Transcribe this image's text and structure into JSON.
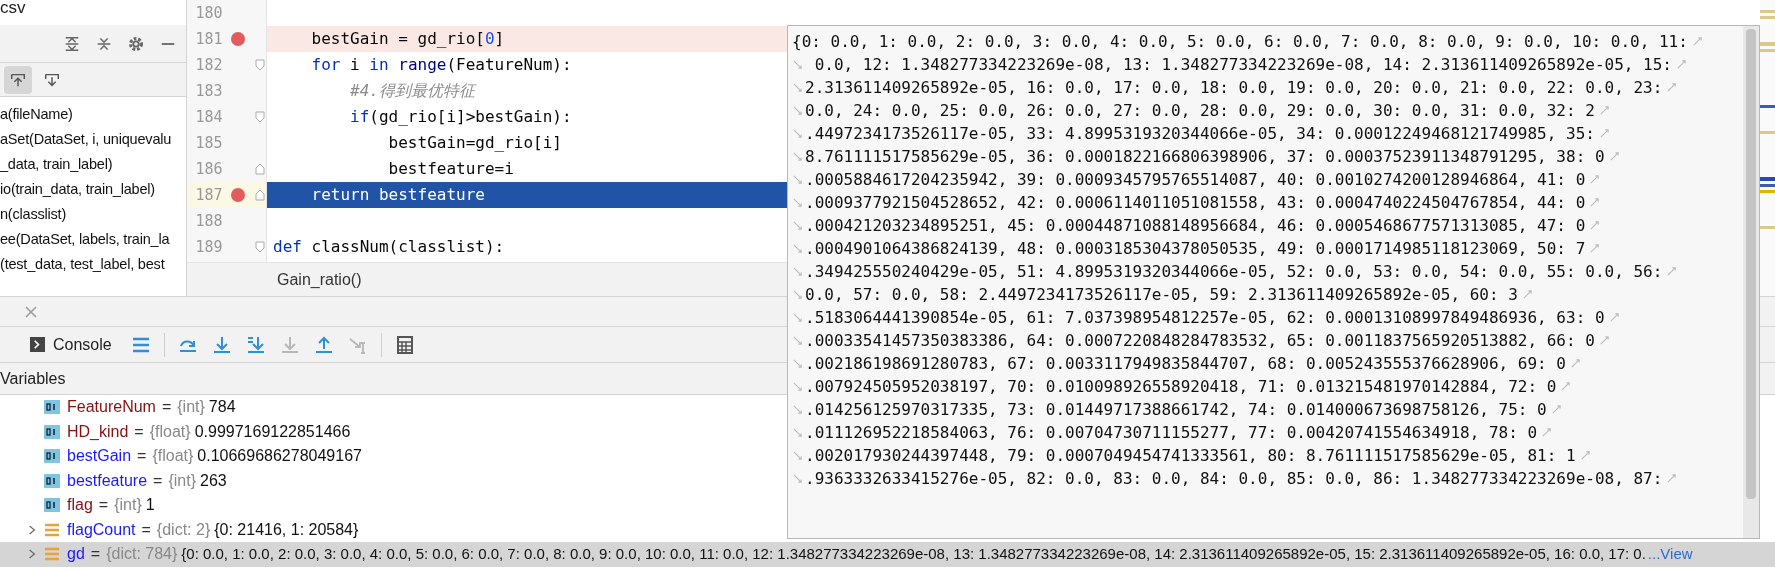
{
  "project_panel": {
    "file_name": "csv",
    "structure_items": [
      "a(fileName)",
      "aSet(DataSet, i, uniquevalu",
      "_data, train_label)",
      "io(train_data, train_label)",
      "n(classlist)",
      "ee(DataSet, labels, train_la",
      "(test_data, test_label, best"
    ],
    "tool_buttons": [
      {
        "kind": "autoscroll-to",
        "selected": true
      },
      {
        "kind": "autoscroll-from",
        "selected": false
      }
    ]
  },
  "editor": {
    "lines": [
      {
        "number": "180",
        "breakpoint": false,
        "current": false,
        "fold_start": false,
        "fold_end": false
      },
      {
        "number": "181",
        "breakpoint": true,
        "current": false,
        "fold_start": false,
        "fold_end": false,
        "code": [
          {
            "text": "    bestGain = gd_rio[",
            "kind": "plain"
          },
          {
            "text": "0",
            "kind": "number"
          },
          {
            "text": "]",
            "kind": "plain"
          }
        ]
      },
      {
        "number": "182",
        "breakpoint": false,
        "current": false,
        "fold_start": true,
        "fold_end": false,
        "code": [
          {
            "text": "    for",
            "kind": "keyword"
          },
          {
            "text": " i ",
            "kind": "plain"
          },
          {
            "text": "in",
            "kind": "keyword"
          },
          {
            "text": " range",
            "kind": "builtin"
          },
          {
            "text": "(FeatureNum):",
            "kind": "plain"
          }
        ]
      },
      {
        "number": "183",
        "breakpoint": false,
        "current": false,
        "fold_start": false,
        "fold_end": false,
        "code": [
          {
            "text": "        #4.得到最优特征",
            "kind": "comment"
          }
        ]
      },
      {
        "number": "184",
        "breakpoint": false,
        "current": false,
        "fold_start": true,
        "fold_end": false,
        "code": [
          {
            "text": "        if",
            "kind": "keyword"
          },
          {
            "text": "(gd_rio[i]>bestGain):",
            "kind": "plain"
          }
        ]
      },
      {
        "number": "185",
        "breakpoint": false,
        "current": false,
        "fold_start": false,
        "fold_end": false,
        "code": [
          {
            "text": "            bestGain=gd_rio[i]",
            "kind": "plain"
          }
        ]
      },
      {
        "number": "186",
        "breakpoint": false,
        "current": false,
        "fold_start": false,
        "fold_end": true,
        "code": [
          {
            "text": "            bestfeature=i",
            "kind": "plain"
          }
        ]
      },
      {
        "number": "187",
        "breakpoint": true,
        "current": true,
        "fold_start": false,
        "fold_end": true,
        "code": [
          {
            "text": "    return",
            "kind": "keyword"
          },
          {
            "text": " bestfeature",
            "kind": "plain"
          }
        ]
      },
      {
        "number": "188",
        "breakpoint": false,
        "current": false,
        "fold_start": false,
        "fold_end": false
      },
      {
        "number": "189",
        "breakpoint": false,
        "current": false,
        "fold_start": true,
        "fold_end": false,
        "code": [
          {
            "text": "def",
            "kind": "keyword"
          },
          {
            "text": " classNum(classlist):",
            "kind": "plain"
          }
        ]
      }
    ],
    "breadcrumb": "Gain_ratio()"
  },
  "value_popup": {
    "lines": [
      "{0: 0.0, 1: 0.0, 2: 0.0, 3: 0.0, 4: 0.0, 5: 0.0, 6: 0.0, 7: 0.0, 8: 0.0, 9: 0.0, 10: 0.0, 11:",
      " 0.0, 12: 1.348277334223269e-08, 13: 1.348277334223269e-08, 14: 2.313611409265892e-05, 15:",
      "2.313611409265892e-05, 16: 0.0, 17: 0.0, 18: 0.0, 19: 0.0, 20: 0.0, 21: 0.0, 22: 0.0, 23:",
      "0.0, 24: 0.0, 25: 0.0, 26: 0.0, 27: 0.0, 28: 0.0, 29: 0.0, 30: 0.0, 31: 0.0, 32: 2",
      ".4497234173526117e-05, 33: 4.8995319320344066e-05, 34: 0.00012249468121749985, 35:",
      "8.761111517585629e-05, 36: 0.0001822166806398906, 37: 0.00037523911348791295, 38: 0",
      ".0005884617204235942, 39: 0.0009345795765514087, 40: 0.0010274200128946864, 41: 0",
      ".0009377921504528652, 42: 0.0006114011051081558, 43: 0.0004740224504767854, 44: 0",
      ".000421203234895251, 45: 0.00044871088148956684, 46: 0.0005468677571313085, 47: 0",
      ".0004901064386824139, 48: 0.0003185304378050535, 49: 0.0001714985118123069, 50: 7",
      ".349425550240429e-05, 51: 4.8995319320344066e-05, 52: 0.0, 53: 0.0, 54: 0.0, 55: 0.0, 56:",
      "0.0, 57: 0.0, 58: 2.4497234173526117e-05, 59: 2.313611409265892e-05, 60: 3",
      ".5183064441390854e-05, 61: 7.037398954812257e-05, 62: 0.00013108997849486936, 63: 0",
      ".00033541457350383386, 64: 0.0007220848284783532, 65: 0.0011837565920513882, 66: 0",
      ".002186198691280783, 67: 0.0033117949835844707, 68: 0.005243555376628906, 69: 0",
      ".007924505952038197, 70: 0.010098926558920418, 71: 0.013215481970142884, 72: 0",
      ".014256125970317335, 73: 0.01449717388661742, 74: 0.014000673698758126, 75: 0",
      ".011126952218584063, 76: 0.00704730711155277, 77: 0.00420741554634918, 78: 0",
      ".002017930244397448, 79: 0.0007049454741333561, 80: 8.761111517585629e-05, 81: 1",
      ".9363332633415276e-05, 82: 0.0, 83: 0.0, 84: 0.0, 85: 0.0, 86: 1.348277334223269e-08, 87:"
    ]
  },
  "debug_panel": {
    "console_tab": "Console",
    "actions": [
      {
        "kind": "frames",
        "disabled": false
      },
      {
        "kind": "step-over",
        "disabled": false
      },
      {
        "kind": "step-into",
        "disabled": false
      },
      {
        "kind": "step-into-my-code",
        "disabled": false
      },
      {
        "kind": "force-step-into",
        "disabled": true
      },
      {
        "kind": "step-out",
        "disabled": false
      },
      {
        "kind": "run-to-cursor",
        "disabled": true
      },
      {
        "kind": "evaluate",
        "disabled": false
      }
    ],
    "variables_title": "Variables",
    "variables": [
      {
        "kind": "scalar",
        "name": "FeatureNum",
        "color": "#871010",
        "separator": "=",
        "type": "{int}",
        "value": "784",
        "selected": false
      },
      {
        "kind": "scalar",
        "name": "HD_kind",
        "color": "#871010",
        "separator": "=",
        "type": "{float}",
        "value": "0.9997169122851466",
        "selected": false
      },
      {
        "kind": "scalar",
        "name": "bestGain",
        "color": "#1a1aff",
        "separator": "=",
        "type": "{float}",
        "value": "0.10669686278049167",
        "selected": false
      },
      {
        "kind": "scalar",
        "name": "bestfeature",
        "color": "#1a1aff",
        "separator": "=",
        "type": "{int}",
        "value": "263",
        "selected": false
      },
      {
        "kind": "scalar",
        "name": "flag",
        "color": "#871010",
        "separator": "=",
        "type": "{int}",
        "value": "1",
        "selected": false
      },
      {
        "kind": "dict",
        "name": "flagCount",
        "color": "#1a1aff",
        "separator": "=",
        "type": "{dict: 2}",
        "value": "{0: 21416, 1: 20584}",
        "selected": false
      },
      {
        "kind": "dict",
        "name": "gd",
        "color": "#1a1aff",
        "separator": "=",
        "type": "{dict: 784}",
        "value": "{0: 0.0, 1: 0.0, 2: 0.0, 3: 0.0, 4: 0.0, 5: 0.0, 6: 0.0, 7: 0.0, 8: 0.0, 9: 0.0, 10: 0.0, 11: 0.0, 12: 1.348277334223269e-08, 13: 1.348277334223269e-08, 14: 2.313611409265892e-05, 15: 2.313611409265892e-05, 16: 0.0, 17: 0.",
        "selected": true,
        "view_link": "...View"
      }
    ]
  }
}
